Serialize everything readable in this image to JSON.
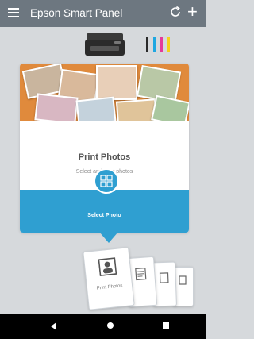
{
  "appbar": {
    "title": "Epson Smart Panel",
    "menu_icon": "menu-icon",
    "refresh_icon": "refresh-icon",
    "add_icon": "plus-icon"
  },
  "status": {
    "ink_colors": [
      "#2a2a2a",
      "#1ea7e1",
      "#e53a9a",
      "#f6d01b"
    ]
  },
  "card": {
    "title": "Print Photos",
    "subtitle": "Select and print photos",
    "button_label": "Select Photo"
  },
  "carousel": {
    "items": [
      {
        "label": "Print Photos",
        "icon": "portrait-icon"
      },
      {
        "label": "",
        "icon": "document-icon"
      },
      {
        "label": "",
        "icon": "document-icon"
      },
      {
        "label": "",
        "icon": "document-icon"
      }
    ]
  },
  "navbar": {
    "back_icon": "back-icon",
    "home_icon": "home-icon",
    "recent_icon": "recent-apps-icon"
  }
}
